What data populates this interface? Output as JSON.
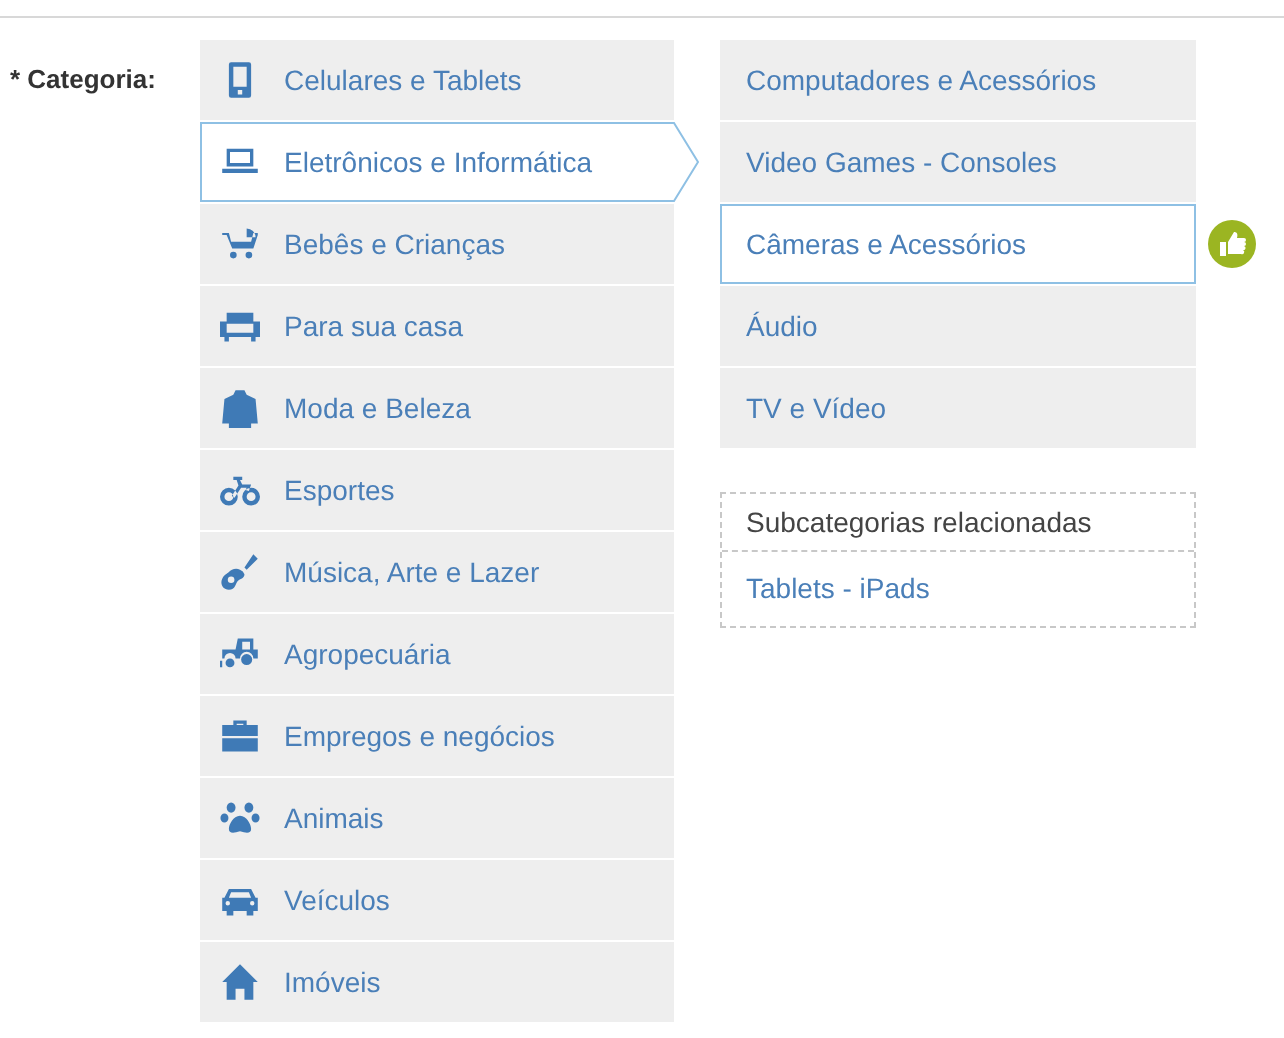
{
  "field_label": "* Categoria:",
  "categories": [
    {
      "label": "Celulares e Tablets",
      "selected": false
    },
    {
      "label": "Eletrônicos e Informática",
      "selected": true
    },
    {
      "label": "Bebês e Crianças",
      "selected": false
    },
    {
      "label": "Para sua casa",
      "selected": false
    },
    {
      "label": "Moda e Beleza",
      "selected": false
    },
    {
      "label": "Esportes",
      "selected": false
    },
    {
      "label": "Música, Arte e Lazer",
      "selected": false
    },
    {
      "label": "Agropecuária",
      "selected": false
    },
    {
      "label": "Empregos e negócios",
      "selected": false
    },
    {
      "label": "Animais",
      "selected": false
    },
    {
      "label": "Veículos",
      "selected": false
    },
    {
      "label": "Imóveis",
      "selected": false
    }
  ],
  "subcategories": [
    {
      "label": "Computadores e Acessórios",
      "selected": false
    },
    {
      "label": "Video Games - Consoles",
      "selected": false
    },
    {
      "label": "Câmeras e Acessórios",
      "selected": true
    },
    {
      "label": "Áudio",
      "selected": false
    },
    {
      "label": "TV e Vídeo",
      "selected": false
    }
  ],
  "related": {
    "title": "Subcategorias relacionadas",
    "items": [
      "Tablets - iPads"
    ]
  }
}
